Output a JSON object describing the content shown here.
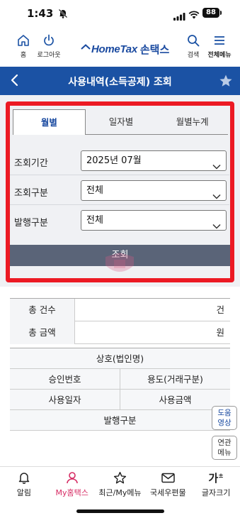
{
  "status_bar": {
    "time": "1:43",
    "battery": "88"
  },
  "header": {
    "home_label": "홈",
    "logout_label": "로그아웃",
    "logo_text": "HomeTax",
    "logo_korean": "손택스",
    "search_label": "검색",
    "menu_label": "전체메뉴"
  },
  "title_bar": {
    "title": "사용내역(소득공제) 조회"
  },
  "tabs": [
    {
      "label": "월별",
      "active": true
    },
    {
      "label": "일자별",
      "active": false
    },
    {
      "label": "월별누계",
      "active": false
    }
  ],
  "form": {
    "period_label": "조회기간",
    "period_value": "2025년 07월",
    "type_label": "조회구분",
    "type_value": "전체",
    "issue_label": "발행구분",
    "issue_value": "전체"
  },
  "query_button": "조회",
  "summary": [
    {
      "label": "총 건수",
      "unit": "건"
    },
    {
      "label": "총 금액",
      "unit": "원"
    }
  ],
  "detail_headers": {
    "merchant": "상호(법인명)",
    "approval_no": "승인번호",
    "purpose": "용도(거래구분)",
    "use_date": "사용일자",
    "use_amount": "사용금액",
    "issue_type": "발행구분"
  },
  "floating": {
    "help_video": [
      "도움",
      "영상"
    ],
    "related_menu": [
      "연관",
      "메뉴"
    ]
  },
  "bottom_nav": [
    {
      "label": "알림",
      "icon": "bell-icon"
    },
    {
      "label": "My홈택스",
      "icon": "person-icon",
      "active": true
    },
    {
      "label": "최근/My메뉴",
      "icon": "star-icon"
    },
    {
      "label": "국세우편물",
      "icon": "mail-icon"
    },
    {
      "label": "글자크기",
      "icon": "font-size-icon"
    }
  ],
  "colors": {
    "brand_blue": "#1b52a4",
    "highlight_red": "#ec1a24",
    "active_pink": "#d62b63",
    "button_gray": "#5a6478"
  }
}
